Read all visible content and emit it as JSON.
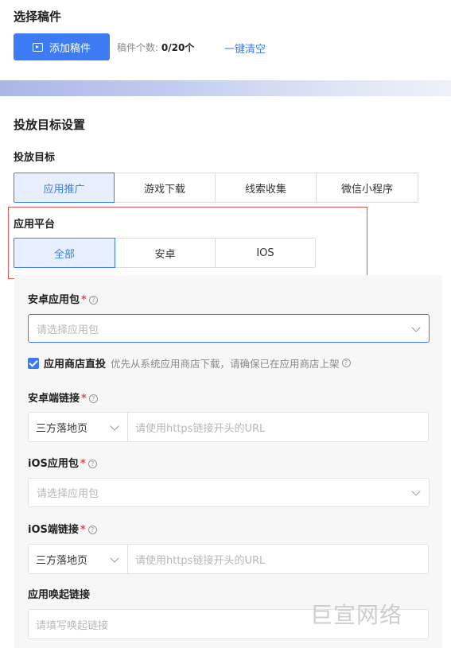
{
  "draft": {
    "title": "选择稿件",
    "add_button": "添加稿件",
    "count_label": "稿件个数:",
    "count_value": "0/20个",
    "clear_link": "一键清空"
  },
  "target_settings": {
    "title": "投放目标设置",
    "target_label": "投放目标",
    "target_options": [
      "应用推广",
      "游戏下载",
      "线索收集",
      "微信小程序"
    ],
    "target_selected": "应用推广",
    "platform_label": "应用平台",
    "platform_options": [
      "全部",
      "安卓",
      "IOS"
    ],
    "platform_selected": "全部"
  },
  "form": {
    "android_package_label": "安卓应用包",
    "android_package_placeholder": "请选择应用包",
    "store_checkbox_label": "应用商店直投",
    "store_checkbox_checked": true,
    "store_hint": "优先从系统应用商店下载，请确保已在应用商店上架",
    "android_link_label": "安卓端链接",
    "android_link_type": "三方落地页",
    "android_link_placeholder": "请使用https链接开头的URL",
    "ios_package_label": "iOS应用包",
    "ios_package_placeholder": "请选择应用包",
    "ios_link_label": "iOS端链接",
    "ios_link_type": "三方落地页",
    "ios_link_placeholder": "请使用https链接开头的URL",
    "wakeup_label": "应用唤起链接",
    "wakeup_placeholder": "请填写唤起链接",
    "required_mark": "*",
    "help_glyph": "?"
  },
  "watermark": "巨宣网络",
  "colors": {
    "primary": "#3d7bf5",
    "highlight_border": "#d9534f",
    "required": "#e5484d"
  }
}
